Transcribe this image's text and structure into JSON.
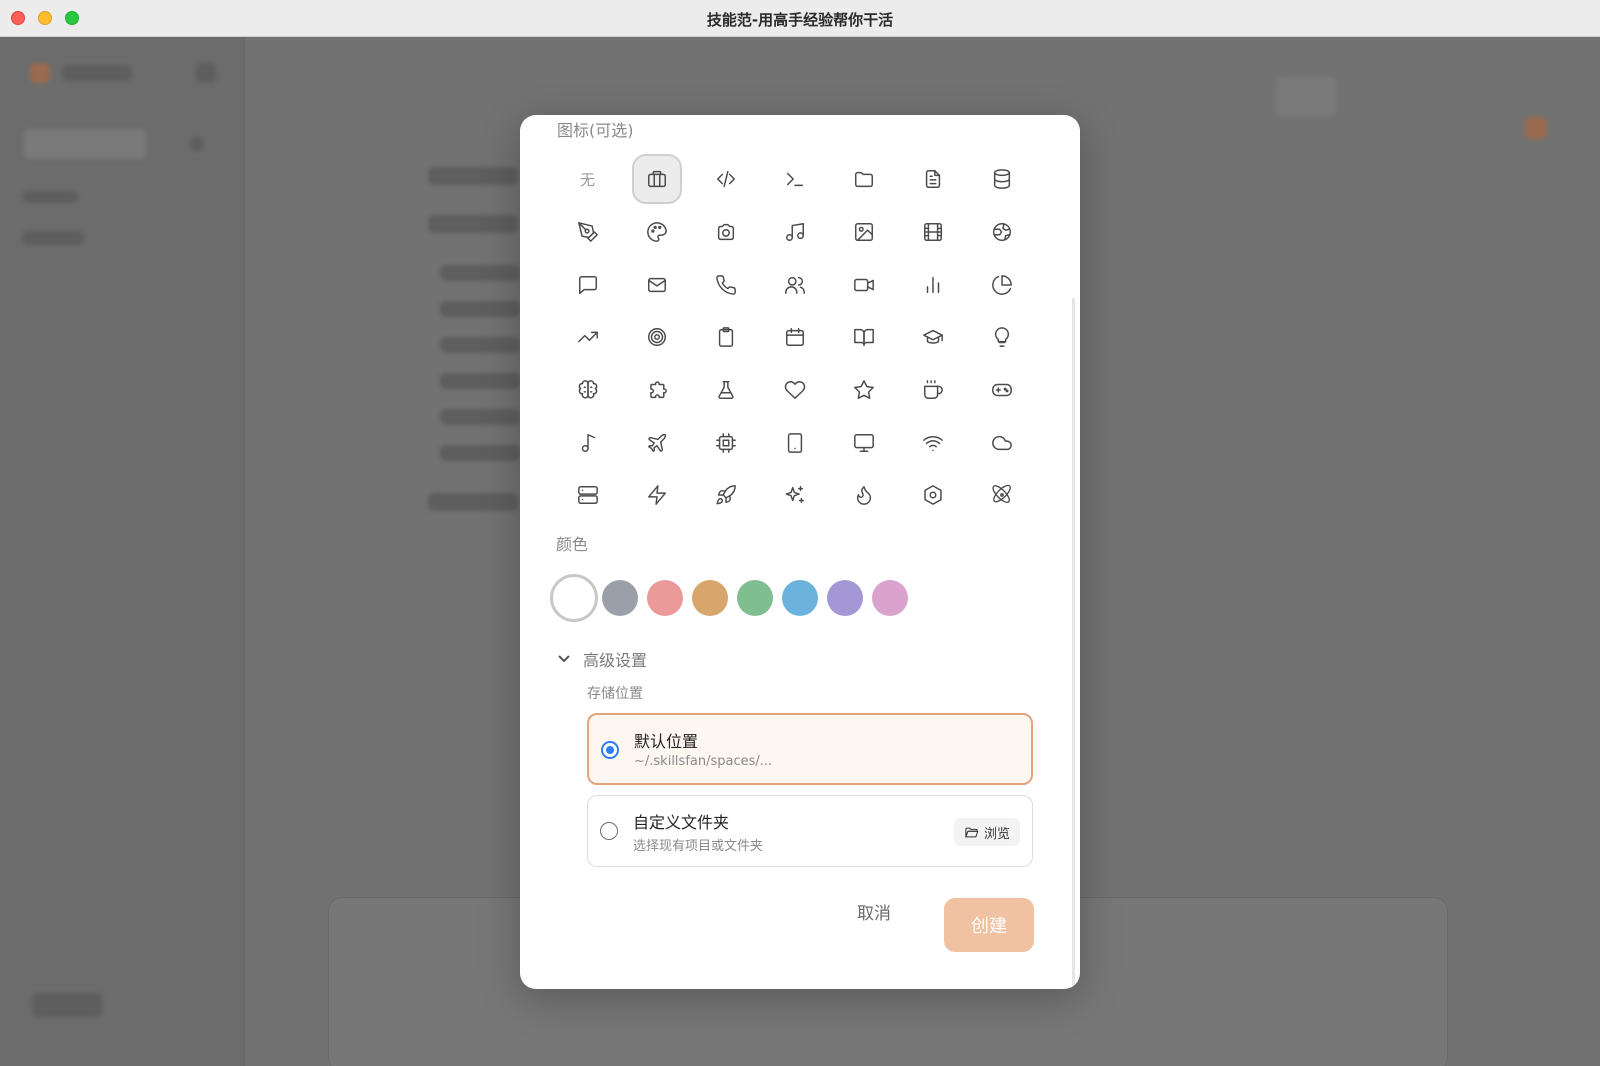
{
  "window": {
    "title": "技能范-用高手经验帮你干活"
  },
  "dialog": {
    "icon_section_label": "图标(可选)",
    "icon_none_label": "无",
    "icons": [
      [
        "none",
        "briefcase-icon",
        "code-icon",
        "terminal-icon",
        "folder-icon",
        "file-text-icon",
        "database-icon"
      ],
      [
        "pen-tool-icon",
        "palette-icon",
        "camera-icon",
        "music-icon",
        "image-icon",
        "film-icon",
        "globe-icon"
      ],
      [
        "message-icon",
        "mail-icon",
        "phone-icon",
        "users-icon",
        "video-icon",
        "bar-chart-icon",
        "pie-chart-icon"
      ],
      [
        "trending-up-icon",
        "target-icon",
        "clipboard-icon",
        "calendar-icon",
        "book-open-icon",
        "graduation-cap-icon",
        "lightbulb-icon"
      ],
      [
        "brain-icon",
        "puzzle-icon",
        "flask-icon",
        "heart-icon",
        "star-icon",
        "coffee-icon",
        "gamepad-icon"
      ],
      [
        "music-note-icon",
        "plane-icon",
        "cpu-icon",
        "tablet-icon",
        "monitor-icon",
        "wifi-icon",
        "cloud-icon"
      ],
      [
        "server-icon",
        "zap-icon",
        "rocket-icon",
        "sparkles-icon",
        "flame-icon",
        "hexagon-icon",
        "atom-icon"
      ]
    ],
    "selected_icon": "briefcase-icon",
    "color_section_label": "颜色",
    "colors": [
      "#ffffff",
      "#9aa0a9",
      "#eb9a9a",
      "#d8a56c",
      "#7fbf8f",
      "#6bb3dc",
      "#a497d6",
      "#d9a2cf"
    ],
    "selected_color": "#ffffff",
    "advanced_label": "高级设置",
    "storage_label": "存储位置",
    "storage_options": [
      {
        "title": "默认位置",
        "subtitle": "~/.skillsfan/spaces/...",
        "selected": true
      },
      {
        "title": "自定义文件夹",
        "subtitle": "选择现有项目或文件夹",
        "selected": false
      }
    ],
    "browse_label": "浏览",
    "cancel_label": "取消",
    "create_label": "创建"
  }
}
